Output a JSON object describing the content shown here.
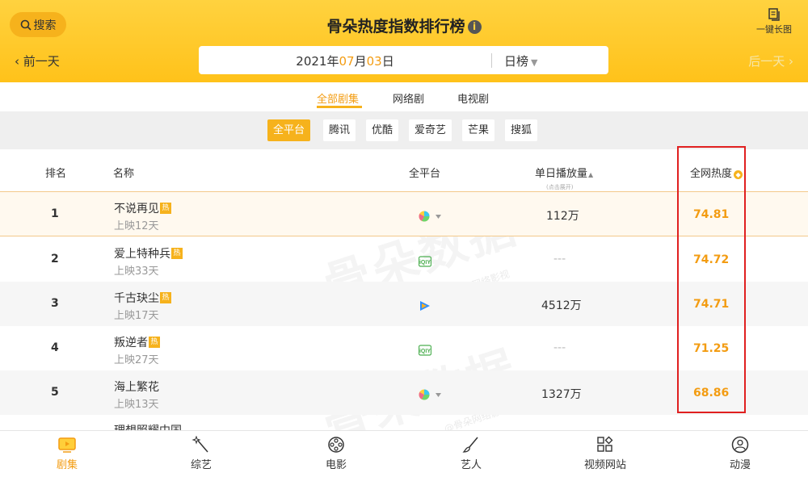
{
  "header": {
    "search_label": "搜索",
    "title": "骨朵热度指数排行榜",
    "longpic_label": "一键长图",
    "prev_label": "前一天",
    "next_label": "后一天",
    "date": {
      "year": "2021",
      "y_sep": "年",
      "month": "07",
      "m_sep": "月",
      "day": "03",
      "d_sep": "日"
    },
    "rank_type": "日榜"
  },
  "tabs": [
    "全部剧集",
    "网络剧",
    "电视剧"
  ],
  "platforms": [
    "全平台",
    "腾讯",
    "优酷",
    "爱奇艺",
    "芒果",
    "搜狐"
  ],
  "table": {
    "headers": {
      "rank": "排名",
      "name": "名称",
      "platform": "全平台",
      "plays": "单日播放量",
      "plays_sub": "(点击展开)",
      "heat": "全网热度"
    },
    "rows": [
      {
        "rank": "1",
        "name": "不说再见",
        "tag": "热",
        "days": "上映12天",
        "platform_icon": "all-platform-icon",
        "plays": "112万",
        "score": "74.81"
      },
      {
        "rank": "2",
        "name": "爱上特种兵",
        "tag": "热",
        "days": "上映33天",
        "platform_icon": "iqiyi-icon",
        "plays": "---",
        "score": "74.72"
      },
      {
        "rank": "3",
        "name": "千古玦尘",
        "tag": "热",
        "days": "上映17天",
        "platform_icon": "tencent-video-icon",
        "plays": "4512万",
        "score": "74.71"
      },
      {
        "rank": "4",
        "name": "叛逆者",
        "tag": "热",
        "days": "上映27天",
        "platform_icon": "iqiyi-icon",
        "plays": "---",
        "score": "71.25"
      },
      {
        "rank": "5",
        "name": "海上繁花",
        "tag": "",
        "days": "上映13天",
        "platform_icon": "all-platform-icon",
        "plays": "1327万",
        "score": "68.86"
      }
    ],
    "partial_row_name": "理想照耀中国"
  },
  "watermark": {
    "text": "骨朵数据",
    "sub": "@骨朵网络影视"
  },
  "bottom_nav": [
    "剧集",
    "综艺",
    "电影",
    "艺人",
    "视频网站",
    "动漫"
  ],
  "colors": {
    "brand_yellow": "#ffc21a",
    "accent_orange": "#f39c12",
    "highlight_red": "#e02020"
  }
}
